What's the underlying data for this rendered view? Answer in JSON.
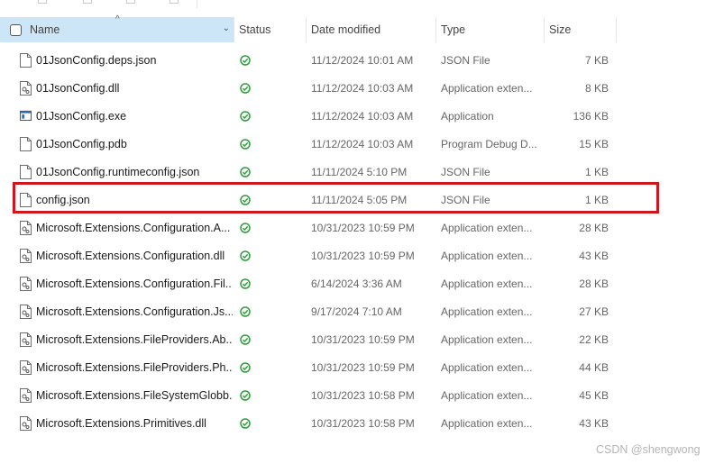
{
  "columns": {
    "name": "Name",
    "status": "Status",
    "date": "Date modified",
    "type": "Type",
    "size": "Size"
  },
  "sort_indicator": "^",
  "header_dropdown": "⌄",
  "status_icon": "check-circle-icon",
  "status_color": "#2e9e3a",
  "highlight_color": "#d0161d",
  "highlighted_file": "config.json",
  "files": [
    {
      "name": "01JsonConfig.deps.json",
      "icon": "json-file-icon",
      "date": "11/12/2024 10:01 AM",
      "type": "JSON File",
      "size": "7 KB"
    },
    {
      "name": "01JsonConfig.dll",
      "icon": "dll-file-icon",
      "date": "11/12/2024 10:03 AM",
      "type": "Application exten...",
      "size": "8 KB"
    },
    {
      "name": "01JsonConfig.exe",
      "icon": "exe-file-icon",
      "date": "11/12/2024 10:03 AM",
      "type": "Application",
      "size": "136 KB"
    },
    {
      "name": "01JsonConfig.pdb",
      "icon": "pdb-file-icon",
      "date": "11/12/2024 10:03 AM",
      "type": "Program Debug D...",
      "size": "15 KB"
    },
    {
      "name": "01JsonConfig.runtimeconfig.json",
      "icon": "json-file-icon",
      "date": "11/11/2024 5:10 PM",
      "type": "JSON File",
      "size": "1 KB"
    },
    {
      "name": "config.json",
      "icon": "json-file-icon",
      "date": "11/11/2024 5:05 PM",
      "type": "JSON File",
      "size": "1 KB"
    },
    {
      "name": "Microsoft.Extensions.Configuration.A...",
      "icon": "dll-file-icon",
      "date": "10/31/2023 10:59 PM",
      "type": "Application exten...",
      "size": "28 KB"
    },
    {
      "name": "Microsoft.Extensions.Configuration.dll",
      "icon": "dll-file-icon",
      "date": "10/31/2023 10:59 PM",
      "type": "Application exten...",
      "size": "43 KB"
    },
    {
      "name": "Microsoft.Extensions.Configuration.Fil...",
      "icon": "dll-file-icon",
      "date": "6/14/2024 3:36 AM",
      "type": "Application exten...",
      "size": "28 KB"
    },
    {
      "name": "Microsoft.Extensions.Configuration.Js...",
      "icon": "dll-file-icon",
      "date": "9/17/2024 7:10 AM",
      "type": "Application exten...",
      "size": "27 KB"
    },
    {
      "name": "Microsoft.Extensions.FileProviders.Ab...",
      "icon": "dll-file-icon",
      "date": "10/31/2023 10:59 PM",
      "type": "Application exten...",
      "size": "22 KB"
    },
    {
      "name": "Microsoft.Extensions.FileProviders.Ph...",
      "icon": "dll-file-icon",
      "date": "10/31/2023 10:59 PM",
      "type": "Application exten...",
      "size": "44 KB"
    },
    {
      "name": "Microsoft.Extensions.FileSystemGlobb...",
      "icon": "dll-file-icon",
      "date": "10/31/2023 10:58 PM",
      "type": "Application exten...",
      "size": "45 KB"
    },
    {
      "name": "Microsoft.Extensions.Primitives.dll",
      "icon": "dll-file-icon",
      "date": "10/31/2023 10:58 PM",
      "type": "Application exten...",
      "size": "43 KB"
    }
  ],
  "watermark": "CSDN @shengwong"
}
